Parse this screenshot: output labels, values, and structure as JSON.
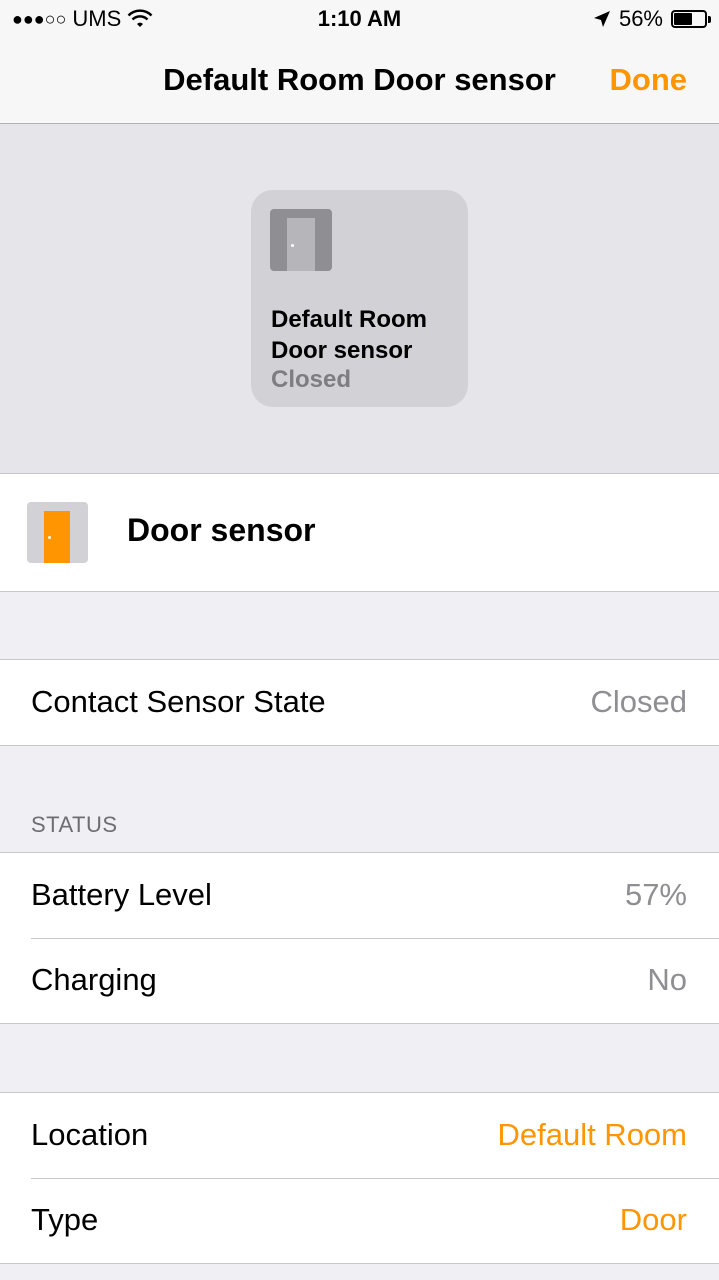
{
  "status_bar": {
    "signal_dots": "●●●○○",
    "carrier": "UMS",
    "time": "1:10 AM",
    "battery_percent": "56%",
    "battery_level": 0.56,
    "icons": [
      "wifi-icon",
      "location-arrow-icon",
      "battery-icon"
    ]
  },
  "nav": {
    "title": "Default Room Door sensor",
    "done_label": "Done"
  },
  "tile": {
    "name": "Default Room Door sensor",
    "state": "Closed"
  },
  "accessory": {
    "name": "Door sensor"
  },
  "contact": {
    "label": "Contact Sensor State",
    "value": "Closed"
  },
  "status_section": {
    "header": "STATUS",
    "battery_label": "Battery Level",
    "battery_value": "57%",
    "charging_label": "Charging",
    "charging_value": "No"
  },
  "settings": {
    "location_label": "Location",
    "location_value": "Default Room",
    "type_label": "Type",
    "type_value": "Door"
  },
  "colors": {
    "accent": "#ff9500",
    "background": "#efeff4",
    "secondary_text": "#8e8e93"
  }
}
